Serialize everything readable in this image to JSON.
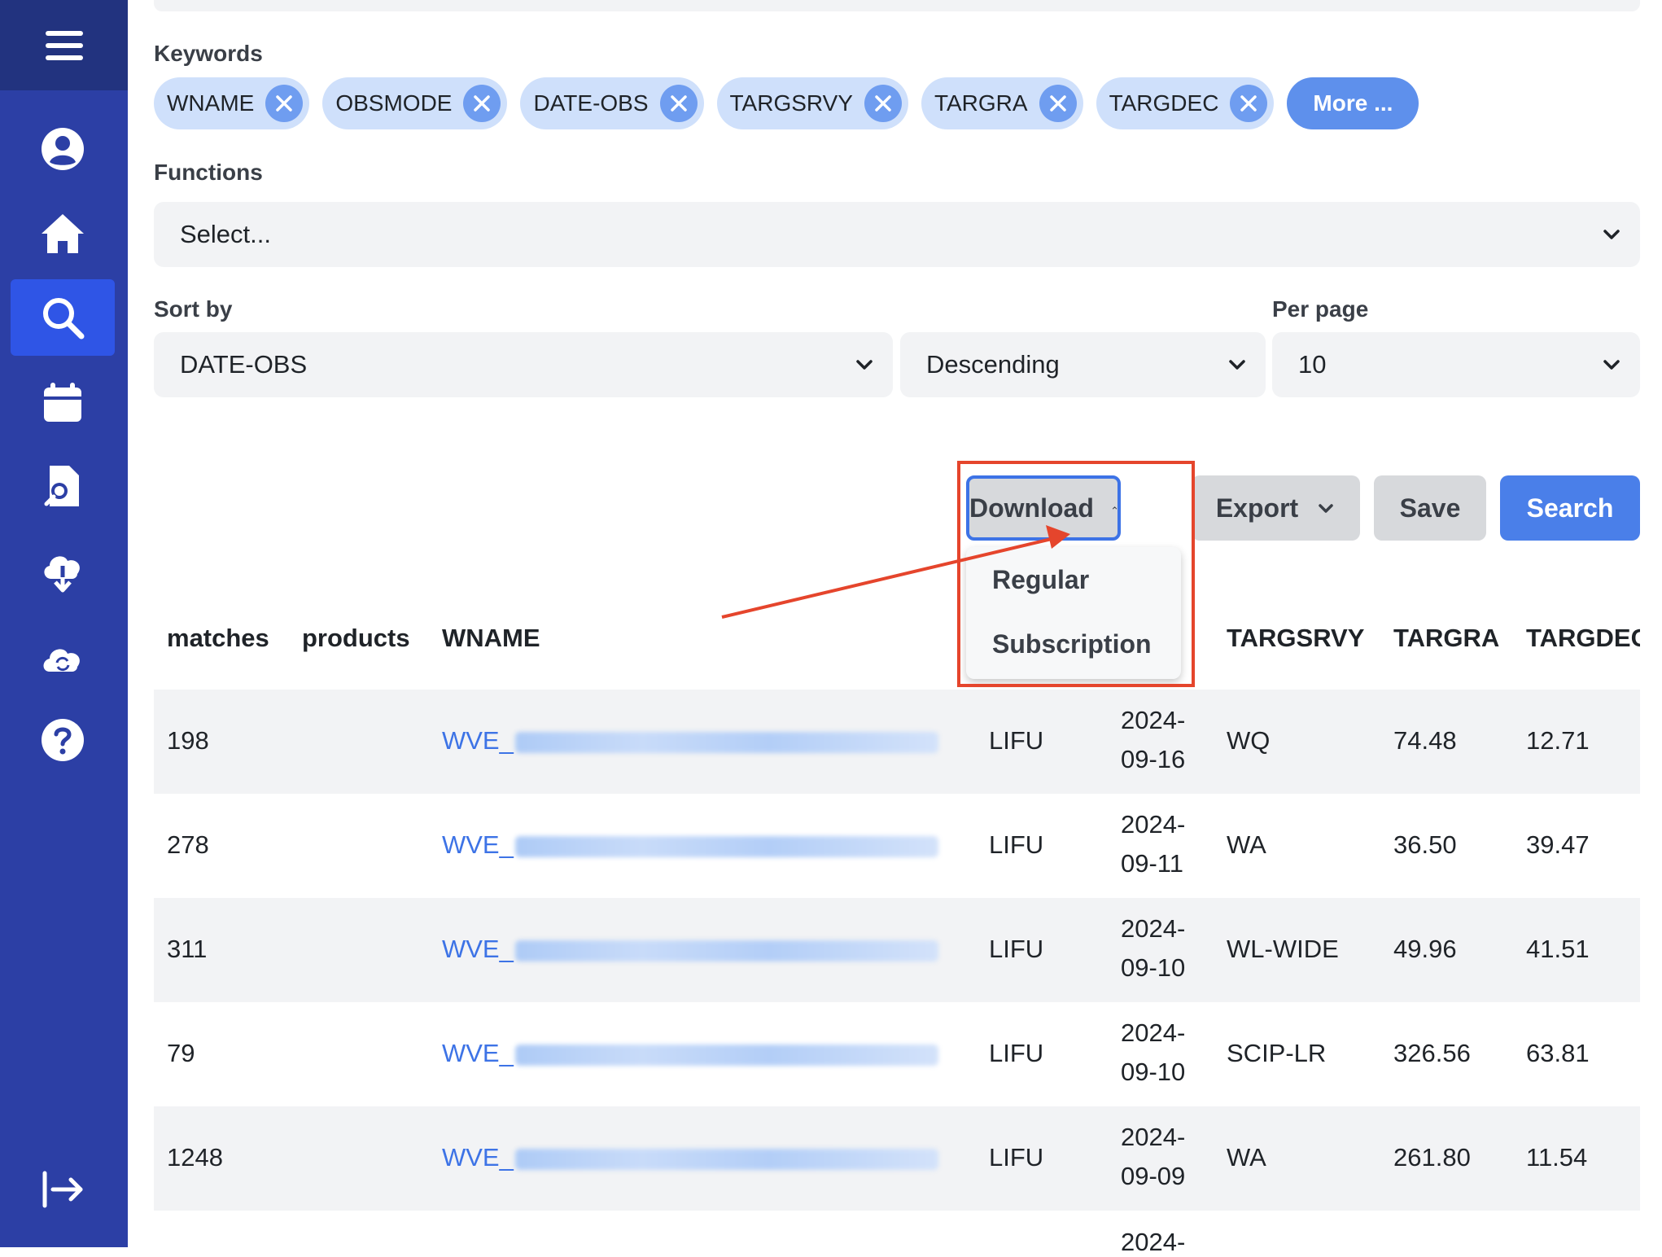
{
  "sidebar": {
    "items": [
      {
        "icon": "hamburger-icon",
        "name": "menu"
      },
      {
        "icon": "user-circle-icon",
        "name": "profile"
      },
      {
        "icon": "home-icon",
        "name": "home"
      },
      {
        "icon": "search-icon",
        "name": "search",
        "active": true
      },
      {
        "icon": "calendar-icon",
        "name": "calendar"
      },
      {
        "icon": "file-search-icon",
        "name": "file-search"
      },
      {
        "icon": "cloud-download-icon",
        "name": "cloud-download"
      },
      {
        "icon": "cloud-sync-icon",
        "name": "cloud-sync"
      },
      {
        "icon": "help-icon",
        "name": "help"
      },
      {
        "icon": "logout-icon",
        "name": "logout"
      }
    ]
  },
  "keywords": {
    "label": "Keywords",
    "chips": [
      "WNAME",
      "OBSMODE",
      "DATE-OBS",
      "TARGSRVY",
      "TARGRA",
      "TARGDEC"
    ],
    "more_label": "More ..."
  },
  "functions": {
    "label": "Functions",
    "placeholder": "Select..."
  },
  "sort": {
    "label": "Sort by",
    "field": "DATE-OBS",
    "order": "Descending",
    "per_page_label": "Per page",
    "per_page": "10"
  },
  "actions": {
    "download": "Download",
    "export": "Export",
    "save": "Save",
    "search": "Search",
    "download_menu": [
      "Regular",
      "Subscription"
    ]
  },
  "table": {
    "headers": [
      "matches",
      "products",
      "WNAME",
      "TARGSRVY",
      "TARGRA",
      "TARGDEC"
    ],
    "rows": [
      {
        "matches": "198",
        "wname": "WVE_",
        "obsmode": "LIFU",
        "date1": "2024-",
        "date2": "09-16",
        "targsrvy": "WQ",
        "targra": "74.48",
        "targdec": "12.71"
      },
      {
        "matches": "278",
        "wname": "WVE_",
        "obsmode": "LIFU",
        "date1": "2024-",
        "date2": "09-11",
        "targsrvy": "WA",
        "targra": "36.50",
        "targdec": "39.47"
      },
      {
        "matches": "311",
        "wname": "WVE_",
        "obsmode": "LIFU",
        "date1": "2024-",
        "date2": "09-10",
        "targsrvy": "WL-WIDE",
        "targra": "49.96",
        "targdec": "41.51"
      },
      {
        "matches": "79",
        "wname": "WVE_",
        "obsmode": "LIFU",
        "date1": "2024-",
        "date2": "09-10",
        "targsrvy": "SCIP-LR",
        "targra": "326.56",
        "targdec": "63.81"
      },
      {
        "matches": "1248",
        "wname": "WVE_",
        "obsmode": "LIFU",
        "date1": "2024-",
        "date2": "09-09",
        "targsrvy": "WA",
        "targra": "261.80",
        "targdec": "11.54"
      }
    ],
    "partial_date": "2024-"
  },
  "colors": {
    "sidebar": "#2c3fa5",
    "accent": "#4a7fe9",
    "annotation": "#e5452c"
  }
}
